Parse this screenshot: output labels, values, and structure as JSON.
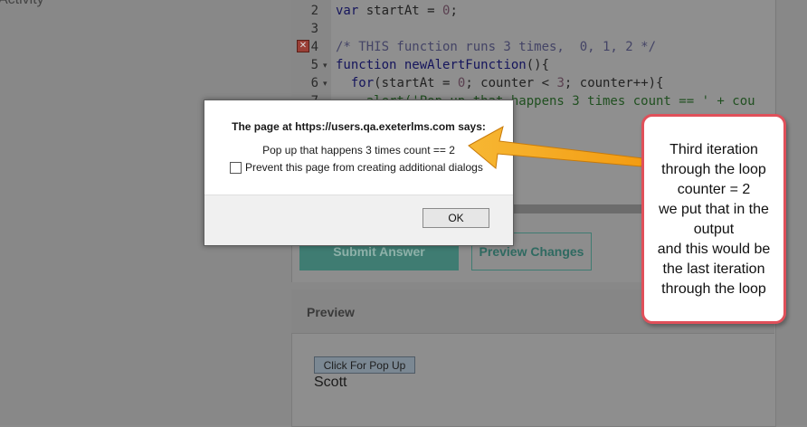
{
  "background": {
    "activity_label": "Activity"
  },
  "editor": {
    "lines": [
      {
        "num": "2",
        "fold": "",
        "parts": [
          {
            "t": "var",
            "c": "kw"
          },
          {
            "t": " startAt = ",
            "c": "txt"
          },
          {
            "t": "0",
            "c": "num"
          },
          {
            "t": ";",
            "c": "txt"
          }
        ]
      },
      {
        "num": "3",
        "fold": "",
        "parts": []
      },
      {
        "num": "4",
        "fold": "",
        "parts": [
          {
            "t": "/* THIS function runs 3 times,  0, 1, 2 */",
            "c": "cmt"
          }
        ]
      },
      {
        "num": "5",
        "fold": "▾",
        "parts": [
          {
            "t": "function",
            "c": "kw"
          },
          {
            "t": " ",
            "c": "txt"
          },
          {
            "t": "newAlertFunction",
            "c": "kw"
          },
          {
            "t": "(){",
            "c": "txt"
          }
        ]
      },
      {
        "num": "6",
        "fold": "▾",
        "parts": [
          {
            "t": "  for",
            "c": "kw"
          },
          {
            "t": "(startAt = ",
            "c": "txt"
          },
          {
            "t": "0",
            "c": "num"
          },
          {
            "t": "; counter < ",
            "c": "txt"
          },
          {
            "t": "3",
            "c": "num"
          },
          {
            "t": "; counter++){",
            "c": "txt"
          }
        ]
      },
      {
        "num": "7",
        "fold": "",
        "parts": [
          {
            "t": "    alert('Pop up that happens 3 times count == ' + cou",
            "c": "str"
          }
        ]
      }
    ],
    "error_marker": "✕"
  },
  "buttons": {
    "submit_label": "Submit Answer",
    "preview_label": "Preview Changes"
  },
  "preview": {
    "title": "Preview",
    "popup_button_label": "Click For Pop Up",
    "output_text": "Scott"
  },
  "dialog": {
    "title": "The page at https://users.qa.exeterlms.com says:",
    "message": "Pop up that happens 3 times count == 2",
    "checkbox_label": "Prevent this page from creating additional dialogs",
    "ok_label": "OK"
  },
  "callout": {
    "lines": [
      "Third iteration",
      "through the loop",
      "counter = 2",
      "we put that in the",
      "output",
      "and this would be",
      "the last iteration",
      "through the loop"
    ],
    "border_color": "#e0505a",
    "arrow_color": "#f5a623"
  }
}
